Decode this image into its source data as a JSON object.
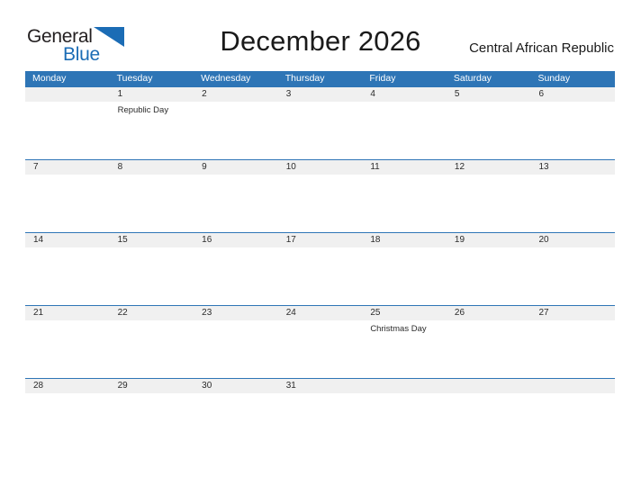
{
  "brand": {
    "name_part1": "General",
    "name_part2": "Blue",
    "flag_icon": "blue-triangle-flag",
    "accent_color": "#1b6cb5"
  },
  "header": {
    "title": "December 2026",
    "country": "Central African Republic"
  },
  "calendar": {
    "header_color": "#2e75b6",
    "band_color": "#f0f0f0",
    "weekdays": [
      "Monday",
      "Tuesday",
      "Wednesday",
      "Thursday",
      "Friday",
      "Saturday",
      "Sunday"
    ],
    "weeks": [
      {
        "days": [
          {
            "num": "",
            "events": []
          },
          {
            "num": "1",
            "events": [
              "Republic Day"
            ]
          },
          {
            "num": "2",
            "events": []
          },
          {
            "num": "3",
            "events": []
          },
          {
            "num": "4",
            "events": []
          },
          {
            "num": "5",
            "events": []
          },
          {
            "num": "6",
            "events": []
          }
        ]
      },
      {
        "days": [
          {
            "num": "7",
            "events": []
          },
          {
            "num": "8",
            "events": []
          },
          {
            "num": "9",
            "events": []
          },
          {
            "num": "10",
            "events": []
          },
          {
            "num": "11",
            "events": []
          },
          {
            "num": "12",
            "events": []
          },
          {
            "num": "13",
            "events": []
          }
        ]
      },
      {
        "days": [
          {
            "num": "14",
            "events": []
          },
          {
            "num": "15",
            "events": []
          },
          {
            "num": "16",
            "events": []
          },
          {
            "num": "17",
            "events": []
          },
          {
            "num": "18",
            "events": []
          },
          {
            "num": "19",
            "events": []
          },
          {
            "num": "20",
            "events": []
          }
        ]
      },
      {
        "days": [
          {
            "num": "21",
            "events": []
          },
          {
            "num": "22",
            "events": []
          },
          {
            "num": "23",
            "events": []
          },
          {
            "num": "24",
            "events": []
          },
          {
            "num": "25",
            "events": [
              "Christmas Day"
            ]
          },
          {
            "num": "26",
            "events": []
          },
          {
            "num": "27",
            "events": []
          }
        ]
      },
      {
        "days": [
          {
            "num": "28",
            "events": []
          },
          {
            "num": "29",
            "events": []
          },
          {
            "num": "30",
            "events": []
          },
          {
            "num": "31",
            "events": []
          },
          {
            "num": "",
            "events": []
          },
          {
            "num": "",
            "events": []
          },
          {
            "num": "",
            "events": []
          }
        ]
      }
    ]
  }
}
